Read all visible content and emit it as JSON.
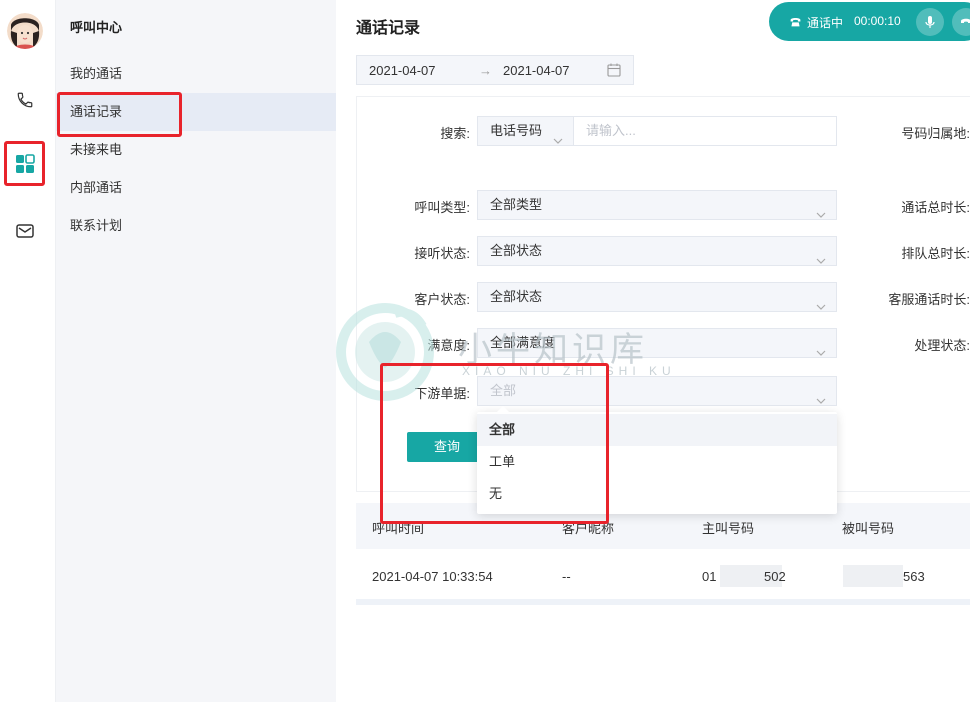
{
  "colors": {
    "accent": "#17a7a4",
    "annotation_red": "#e8232b",
    "sidebar_bg": "#f5f6f9",
    "sidebar_active_bg": "#e6ebf5"
  },
  "rail": {
    "icons": [
      "avatar",
      "phone-icon",
      "grid-apps-icon",
      "mail-icon"
    ]
  },
  "sidebar": {
    "title": "呼叫中心",
    "items": [
      {
        "label": "我的通话"
      },
      {
        "label": "通话记录"
      },
      {
        "label": "未接来电"
      },
      {
        "label": "内部通话"
      },
      {
        "label": "联系计划"
      }
    ]
  },
  "call_bar": {
    "status": "通话中",
    "timer": "00:00:10"
  },
  "main": {
    "title": "通话记录",
    "date_start": "2021-04-07",
    "date_end": "2021-04-07",
    "date_arrow": "→"
  },
  "form": {
    "search_label": "搜索:",
    "search_type": "电话号码",
    "search_placeholder": "请输入...",
    "call_type_label": "呼叫类型:",
    "call_type_value": "全部类型",
    "answer_status_label": "接听状态:",
    "answer_status_value": "全部状态",
    "customer_status_label": "客户状态:",
    "customer_status_value": "全部状态",
    "satisfaction_label": "满意度:",
    "satisfaction_value": "全部满意度",
    "downstream_label": "下游单据:",
    "downstream_value": "全部",
    "right_labels": [
      "号码归属地:",
      "通话总时长:",
      "排队总时长:",
      "客服通话时长:",
      "处理状态:"
    ],
    "query_button": "查询"
  },
  "dropdown": {
    "options": [
      "全部",
      "工单",
      "无"
    ],
    "selected": "全部"
  },
  "table": {
    "headers": [
      "呼叫时间",
      "客户昵称",
      "主叫号码",
      "被叫号码"
    ],
    "rows": [
      {
        "time": "2021-04-07 10:33:54",
        "nickname": "--",
        "caller": "01",
        "caller_tail": "502",
        "callee_tail": "563"
      }
    ]
  },
  "watermark": {
    "text": "小牛知识库",
    "sub": "XIAO NIU ZHI SHI KU"
  }
}
